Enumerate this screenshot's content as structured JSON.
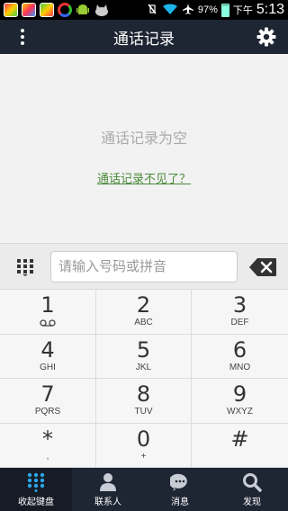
{
  "status_bar": {
    "battery": "97%",
    "period": "下午",
    "time": "5:13"
  },
  "header": {
    "title": "通话记录"
  },
  "empty_state": {
    "message": "通话记录为空",
    "link": "通话记录不见了？"
  },
  "input": {
    "placeholder": "请输入号码或拼音",
    "value": ""
  },
  "keypad": {
    "keys": [
      {
        "digit": "1",
        "letters": ""
      },
      {
        "digit": "2",
        "letters": "ABC"
      },
      {
        "digit": "3",
        "letters": "DEF"
      },
      {
        "digit": "4",
        "letters": "GHI"
      },
      {
        "digit": "5",
        "letters": "JKL"
      },
      {
        "digit": "6",
        "letters": "MNO"
      },
      {
        "digit": "7",
        "letters": "PQRS"
      },
      {
        "digit": "8",
        "letters": "TUV"
      },
      {
        "digit": "9",
        "letters": "WXYZ"
      },
      {
        "digit": "*",
        "letters": ","
      },
      {
        "digit": "0",
        "letters": "+"
      },
      {
        "digit": "#",
        "letters": ""
      }
    ]
  },
  "bottom_nav": {
    "items": [
      {
        "label": "收起键盘",
        "icon": "keypad-icon"
      },
      {
        "label": "联系人",
        "icon": "contact-icon"
      },
      {
        "label": "消息",
        "icon": "message-icon"
      },
      {
        "label": "发现",
        "icon": "search-icon"
      }
    ]
  },
  "colors": {
    "header_bg": "#1e2533",
    "link": "#4a8a3a",
    "active_nav_icon": "#29a8e6"
  }
}
